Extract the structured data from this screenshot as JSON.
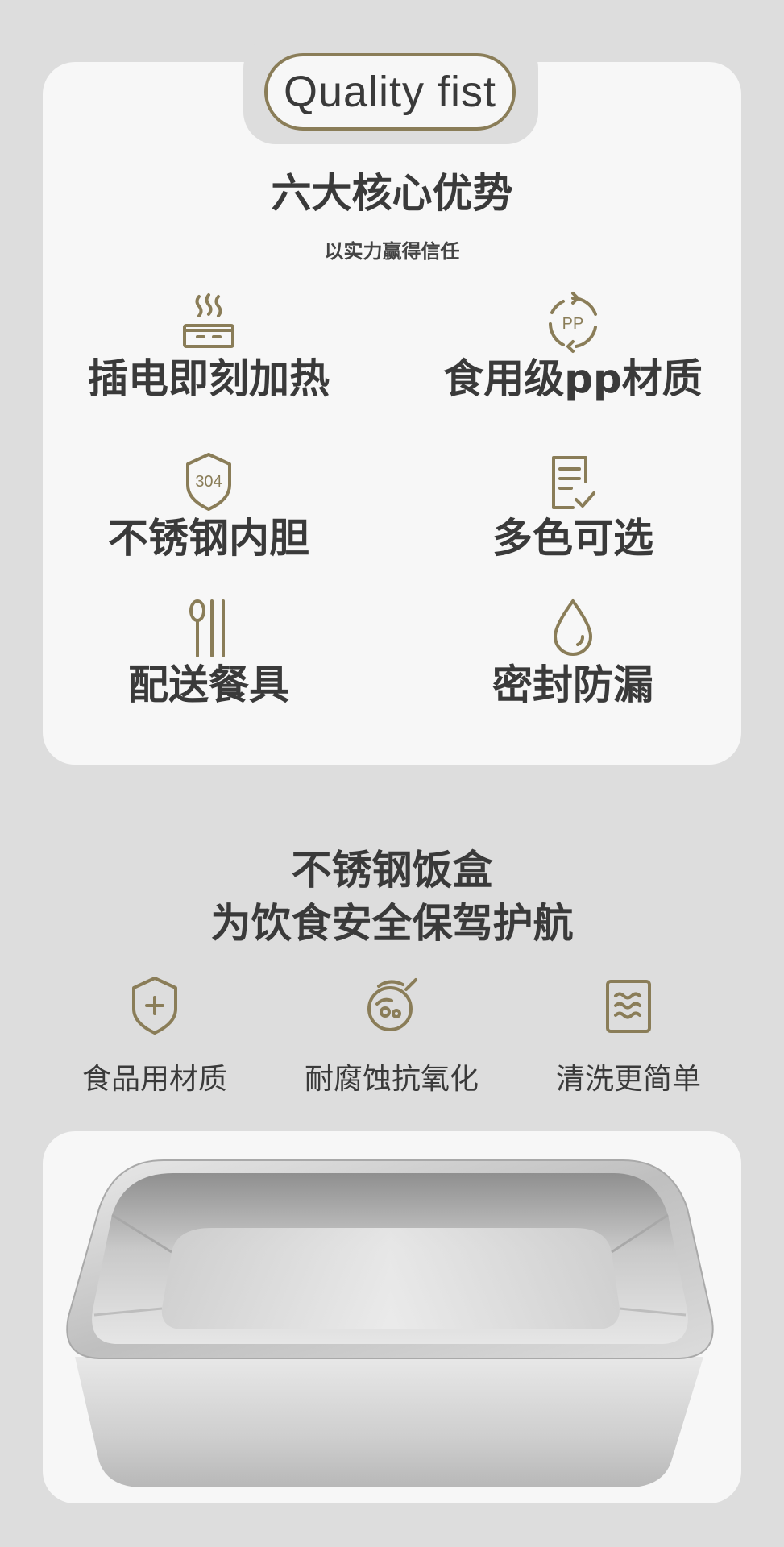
{
  "badge": {
    "text": "Quality fist"
  },
  "section1": {
    "title": "六大核心优势",
    "subtitle": "以实力赢得信任",
    "features": [
      {
        "icon": "heater-icon",
        "label": "插电即刻加热"
      },
      {
        "icon": "pp-recycle-icon",
        "label": "食用级pp材质"
      },
      {
        "icon": "shield-304-icon",
        "label": "不锈钢内胆",
        "icon_text": "304"
      },
      {
        "icon": "document-check-icon",
        "label": "多色可选"
      },
      {
        "icon": "utensils-icon",
        "label": "配送餐具"
      },
      {
        "icon": "water-drop-icon",
        "label": "密封防漏"
      }
    ]
  },
  "section2": {
    "title_line1": "不锈钢饭盒",
    "title_line2": "为饮食安全保驾护航",
    "benefits": [
      {
        "icon": "shield-plus-icon",
        "label": "食品用材质"
      },
      {
        "icon": "corrosion-icon",
        "label": "耐腐蚀抗氧化"
      },
      {
        "icon": "wash-icon",
        "label": "清洗更简单"
      }
    ]
  },
  "colors": {
    "accent": "#8a7d58",
    "card": "#f7f7f7",
    "background": "#dddddd",
    "text": "#3a3a3a"
  }
}
